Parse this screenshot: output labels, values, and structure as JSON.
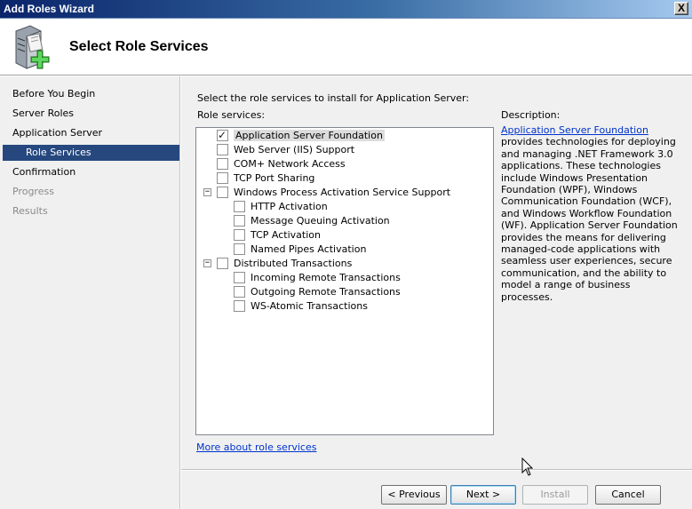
{
  "window": {
    "title": "Add Roles Wizard",
    "close_label": "X"
  },
  "header": {
    "title": "Select Role Services",
    "icon": "server-add-icon"
  },
  "nav": {
    "items": [
      {
        "label": "Before You Begin",
        "state": "normal"
      },
      {
        "label": "Server Roles",
        "state": "normal"
      },
      {
        "label": "Application Server",
        "state": "normal"
      },
      {
        "label": "Role Services",
        "state": "selected"
      },
      {
        "label": "Confirmation",
        "state": "normal"
      },
      {
        "label": "Progress",
        "state": "disabled"
      },
      {
        "label": "Results",
        "state": "disabled"
      }
    ]
  },
  "main": {
    "instruction": "Select the role services to install for Application Server:",
    "role_services_label": "Role services:",
    "services": [
      {
        "label": "Application Server Foundation",
        "checked": true,
        "highlighted": true
      },
      {
        "label": "Web Server (IIS) Support",
        "checked": false
      },
      {
        "label": "COM+ Network Access",
        "checked": false
      },
      {
        "label": "TCP Port Sharing",
        "checked": false
      },
      {
        "label": "Windows Process Activation Service Support",
        "checked": false,
        "expander": "−"
      },
      {
        "label": "HTTP Activation",
        "checked": false
      },
      {
        "label": "Message Queuing Activation",
        "checked": false
      },
      {
        "label": "TCP Activation",
        "checked": false
      },
      {
        "label": "Named Pipes Activation",
        "checked": false
      },
      {
        "label": "Distributed Transactions",
        "checked": false,
        "expander": "−"
      },
      {
        "label": "Incoming Remote Transactions",
        "checked": false
      },
      {
        "label": "Outgoing Remote Transactions",
        "checked": false
      },
      {
        "label": "WS-Atomic Transactions",
        "checked": false
      }
    ],
    "description_label": "Description:",
    "description_link": "Application Server Foundation",
    "description_lines": [
      "provides technologies for deploying",
      "and managing .NET Framework 3.0",
      "applications. These technologies",
      "include Windows Presentation",
      "Foundation (WPF), Windows",
      "Communication Foundation (WCF),",
      "and Windows Workflow Foundation",
      "(WF). Application Server Foundation",
      "provides the means for delivering",
      "managed-code applications with",
      "seamless user experiences, secure",
      "communication, and the ability to",
      "model a range of business processes."
    ],
    "more_link": "More about role services"
  },
  "buttons": {
    "previous": "< Previous",
    "next": "Next >",
    "install": "Install",
    "cancel": "Cancel"
  }
}
